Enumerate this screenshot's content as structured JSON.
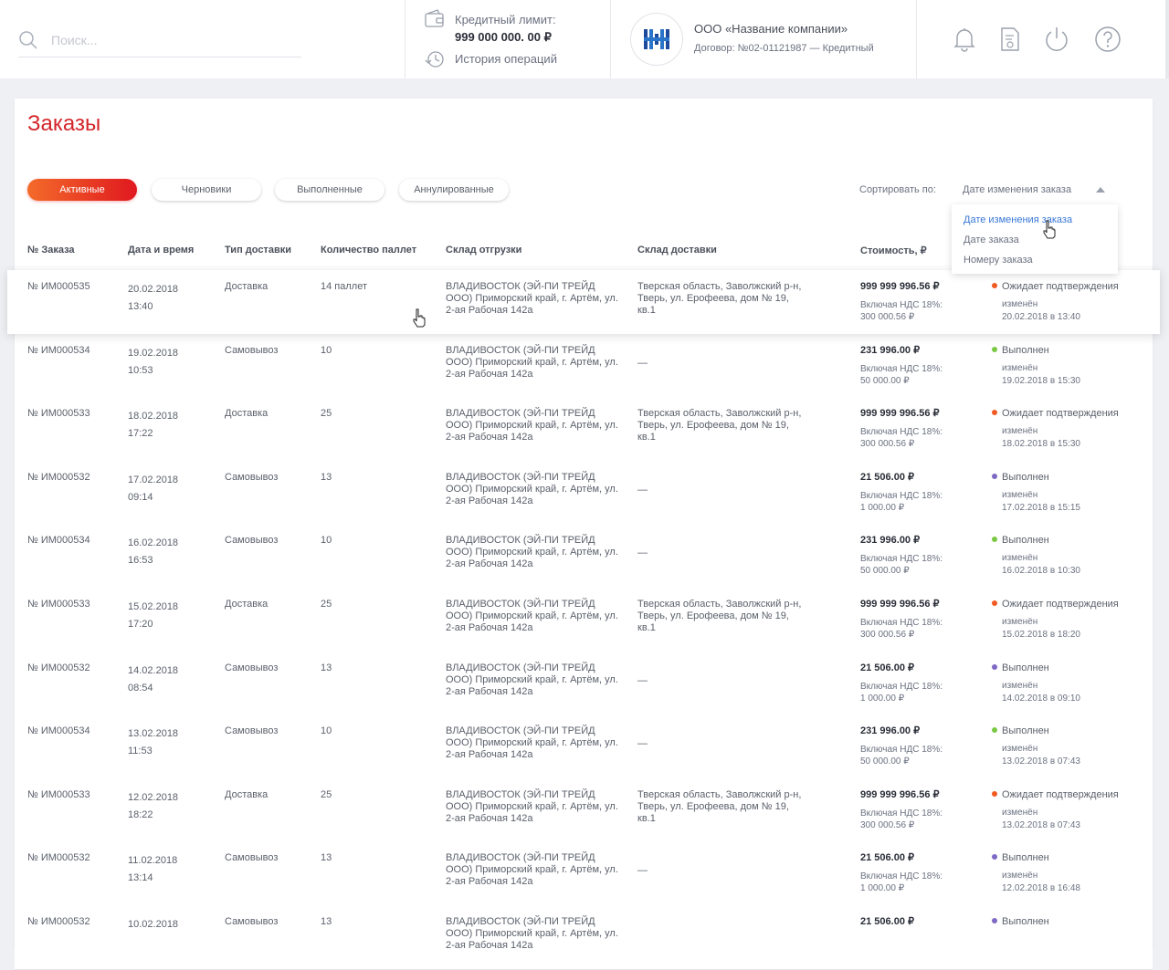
{
  "header": {
    "search_placeholder": "Поиск...",
    "credit_label": "Кредитный лимит:",
    "credit_value": "999 000 000. 00 ₽",
    "history_label": "История операций",
    "company_name": "ООО «Название компании»",
    "contract": "Договор: №02-01121987 — Кредитный"
  },
  "page": {
    "title": "Заказы",
    "tabs": [
      "Активные",
      "Черновики",
      "Выполненные",
      "Аннулированные"
    ],
    "sort_label": "Сортировать по:",
    "sort_value": "Дате изменения заказа",
    "sort_options": [
      "Дате изменения заказа",
      "Дате заказа",
      "Номеру заказа"
    ]
  },
  "table": {
    "columns": [
      "№ Заказа",
      "Дата и время",
      "Тип доставки",
      "Количество паллет",
      "Склад отгрузки",
      "Склад доставки",
      "Стоимость, ₽"
    ],
    "rows": [
      {
        "num": "№ ИМ000535",
        "date": "20.02.2018",
        "time": "13:40",
        "type": "Доставка",
        "qty": "14 паллет",
        "from": "ВЛАДИВОСТОК (ЭЙ-ПИ ТРЕЙД ООО) Приморский край, г. Артём, ул. 2-ая Рабочая 142а",
        "to": "Тверская область, Заволжский р-н, Тверь, ул. Ерофеева, дом № 19, кв.1",
        "price": "999 999 996.56 ₽",
        "vat_label": "Включая НДС 18%:",
        "vat": "300 000.56 ₽",
        "status": "Ожидает подтверждения",
        "status_color": "#f05a22",
        "changed": "изменён",
        "changed_at": "20.02.2018 в 13:40"
      },
      {
        "num": "№ ИМ000534",
        "date": "19.02.2018",
        "time": "10:53",
        "type": "Самовывоз",
        "qty": "10",
        "from": "ВЛАДИВОСТОК (ЭЙ-ПИ ТРЕЙД ООО) Приморский край, г. Артём, ул. 2-ая Рабочая 142а",
        "to": "—",
        "price": "231 996.00 ₽",
        "vat_label": "Включая НДС 18%:",
        "vat": "50 000.00 ₽",
        "status": "Выполнен",
        "status_color": "#7ac943",
        "changed": "изменён",
        "changed_at": "19.02.2018 в 15:30"
      },
      {
        "num": "№ ИМ000533",
        "date": "18.02.2018",
        "time": "17:22",
        "type": "Доставка",
        "qty": "25",
        "from": "ВЛАДИВОСТОК (ЭЙ-ПИ ТРЕЙД ООО) Приморский край, г. Артём, ул. 2-ая Рабочая 142а",
        "to": "Тверская область, Заволжский р-н, Тверь, ул. Ерофеева, дом № 19, кв.1",
        "price": "999 999 996.56 ₽",
        "vat_label": "Включая НДС 18%:",
        "vat": "300 000.56 ₽",
        "status": "Ожидает подтверждения",
        "status_color": "#f05a22",
        "changed": "изменён",
        "changed_at": "18.02.2018 в 15:30"
      },
      {
        "num": "№ ИМ000532",
        "date": "17.02.2018",
        "time": "09:14",
        "type": "Самовывоз",
        "qty": "13",
        "from": "ВЛАДИВОСТОК (ЭЙ-ПИ ТРЕЙД ООО) Приморский край, г. Артём, ул. 2-ая Рабочая 142а",
        "to": "—",
        "price": "21 506.00 ₽",
        "vat_label": "Включая НДС 18%:",
        "vat": "1 000.00 ₽",
        "status": "Выполнен",
        "status_color": "#7e69c4",
        "changed": "изменён",
        "changed_at": "17.02.2018 в 15:15"
      },
      {
        "num": "№ ИМ000534",
        "date": "16.02.2018",
        "time": "16:53",
        "type": "Самовывоз",
        "qty": "10",
        "from": "ВЛАДИВОСТОК (ЭЙ-ПИ ТРЕЙД ООО) Приморский край, г. Артём, ул. 2-ая Рабочая 142а",
        "to": "—",
        "price": "231 996.00 ₽",
        "vat_label": "Включая НДС 18%:",
        "vat": "50 000.00 ₽",
        "status": "Выполнен",
        "status_color": "#7ac943",
        "changed": "изменён",
        "changed_at": "16.02.2018 в 10:30"
      },
      {
        "num": "№ ИМ000533",
        "date": "15.02.2018",
        "time": "17:20",
        "type": "Доставка",
        "qty": "25",
        "from": "ВЛАДИВОСТОК (ЭЙ-ПИ ТРЕЙД ООО) Приморский край, г. Артём, ул. 2-ая Рабочая 142а",
        "to": "Тверская область, Заволжский р-н, Тверь, ул. Ерофеева, дом № 19, кв.1",
        "price": "999 999 996.56 ₽",
        "vat_label": "Включая НДС 18%:",
        "vat": "300 000.56 ₽",
        "status": "Ожидает подтверждения",
        "status_color": "#f05a22",
        "changed": "изменён",
        "changed_at": "15.02.2018 в 18:20"
      },
      {
        "num": "№ ИМ000532",
        "date": "14.02.2018",
        "time": "08:54",
        "type": "Самовывоз",
        "qty": "13",
        "from": "ВЛАДИВОСТОК (ЭЙ-ПИ ТРЕЙД ООО) Приморский край, г. Артём, ул. 2-ая Рабочая 142а",
        "to": "—",
        "price": "21 506.00 ₽",
        "vat_label": "Включая НДС 18%:",
        "vat": "1 000.00 ₽",
        "status": "Выполнен",
        "status_color": "#7e69c4",
        "changed": "изменён",
        "changed_at": "14.02.2018 в 09:10"
      },
      {
        "num": "№ ИМ000534",
        "date": "13.02.2018",
        "time": "11:53",
        "type": "Самовывоз",
        "qty": "10",
        "from": "ВЛАДИВОСТОК (ЭЙ-ПИ ТРЕЙД ООО) Приморский край, г. Артём, ул. 2-ая Рабочая 142а",
        "to": "—",
        "price": "231 996.00 ₽",
        "vat_label": "Включая НДС 18%:",
        "vat": "50 000.00 ₽",
        "status": "Выполнен",
        "status_color": "#7ac943",
        "changed": "изменён",
        "changed_at": "13.02.2018 в 07:43"
      },
      {
        "num": "№ ИМ000533",
        "date": "12.02.2018",
        "time": "18:22",
        "type": "Доставка",
        "qty": "25",
        "from": "ВЛАДИВОСТОК (ЭЙ-ПИ ТРЕЙД ООО) Приморский край, г. Артём, ул. 2-ая Рабочая 142а",
        "to": "Тверская область, Заволжский р-н, Тверь, ул. Ерофеева, дом № 19, кв.1",
        "price": "999 999 996.56 ₽",
        "vat_label": "Включая НДС 18%:",
        "vat": "300 000.56 ₽",
        "status": "Ожидает подтверждения",
        "status_color": "#f05a22",
        "changed": "изменён",
        "changed_at": "13.02.2018 в 07:43"
      },
      {
        "num": "№ ИМ000532",
        "date": "11.02.2018",
        "time": "13:14",
        "type": "Самовывоз",
        "qty": "13",
        "from": "ВЛАДИВОСТОК (ЭЙ-ПИ ТРЕЙД ООО) Приморский край, г. Артём, ул. 2-ая Рабочая 142а",
        "to": "—",
        "price": "21 506.00 ₽",
        "vat_label": "Включая НДС 18%:",
        "vat": "1 000.00 ₽",
        "status": "Выполнен",
        "status_color": "#7e69c4",
        "changed": "изменён",
        "changed_at": "12.02.2018 в 16:48"
      },
      {
        "num": "№ ИМ000532",
        "date": "10.02.2018",
        "time": "",
        "type": "Самовывоз",
        "qty": "13",
        "from": "ВЛАДИВОСТОК (ЭЙ-ПИ ТРЕЙД ООО) Приморский край, г. Артём, ул. 2-ая Рабочая 142а",
        "to": "",
        "price": "21 506.00 ₽",
        "vat_label": "",
        "vat": "",
        "status": "Выполнен",
        "status_color": "#7e69c4",
        "changed": "",
        "changed_at": ""
      }
    ]
  },
  "icons": [
    "search-icon",
    "wallet-icon",
    "history-icon",
    "company-logo",
    "bell-icon",
    "document-icon",
    "power-icon",
    "help-icon",
    "pointer-cursor-icon"
  ],
  "colors": {
    "accent": "#e0181f",
    "link": "#3a78d6",
    "pending": "#f05a22",
    "done_green": "#7ac943",
    "done_purple": "#7e69c4"
  }
}
